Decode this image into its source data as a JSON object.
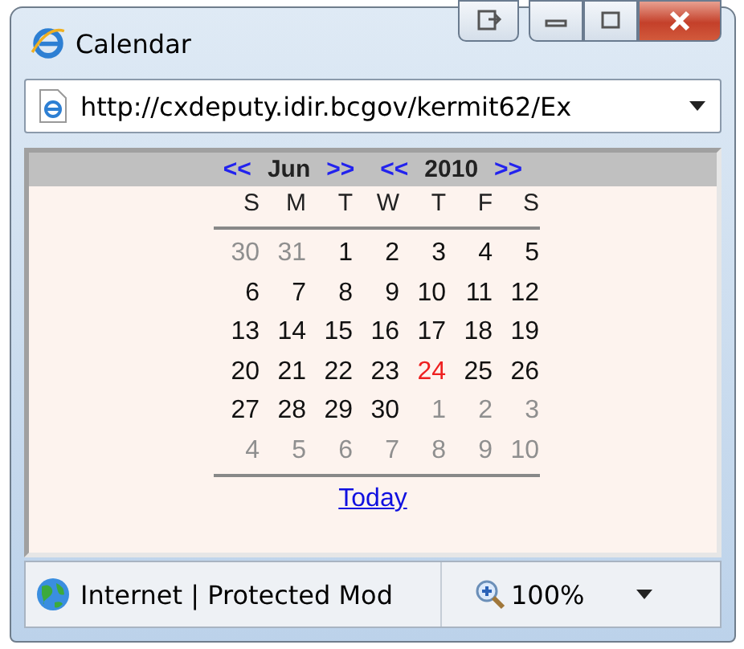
{
  "window": {
    "title": "Calendar"
  },
  "address_bar": {
    "value": "http://cxdeputy.idir.bcgov/kermit62/Ex"
  },
  "calendar": {
    "prev_month": "<<",
    "month": "Jun",
    "next_month": ">>",
    "prev_year": "<<",
    "year": "2010",
    "next_year": ">>",
    "weekdays": [
      "S",
      "M",
      "T",
      "W",
      "T",
      "F",
      "S"
    ],
    "weeks": [
      [
        {
          "day": "30",
          "other_month": true,
          "today": false
        },
        {
          "day": "31",
          "other_month": true,
          "today": false
        },
        {
          "day": "1",
          "other_month": false,
          "today": false
        },
        {
          "day": "2",
          "other_month": false,
          "today": false
        },
        {
          "day": "3",
          "other_month": false,
          "today": false
        },
        {
          "day": "4",
          "other_month": false,
          "today": false
        },
        {
          "day": "5",
          "other_month": false,
          "today": false
        }
      ],
      [
        {
          "day": "6",
          "other_month": false,
          "today": false
        },
        {
          "day": "7",
          "other_month": false,
          "today": false
        },
        {
          "day": "8",
          "other_month": false,
          "today": false
        },
        {
          "day": "9",
          "other_month": false,
          "today": false
        },
        {
          "day": "10",
          "other_month": false,
          "today": false
        },
        {
          "day": "11",
          "other_month": false,
          "today": false
        },
        {
          "day": "12",
          "other_month": false,
          "today": false
        }
      ],
      [
        {
          "day": "13",
          "other_month": false,
          "today": false
        },
        {
          "day": "14",
          "other_month": false,
          "today": false
        },
        {
          "day": "15",
          "other_month": false,
          "today": false
        },
        {
          "day": "16",
          "other_month": false,
          "today": false
        },
        {
          "day": "17",
          "other_month": false,
          "today": false
        },
        {
          "day": "18",
          "other_month": false,
          "today": false
        },
        {
          "day": "19",
          "other_month": false,
          "today": false
        }
      ],
      [
        {
          "day": "20",
          "other_month": false,
          "today": false
        },
        {
          "day": "21",
          "other_month": false,
          "today": false
        },
        {
          "day": "22",
          "other_month": false,
          "today": false
        },
        {
          "day": "23",
          "other_month": false,
          "today": false
        },
        {
          "day": "24",
          "other_month": false,
          "today": true
        },
        {
          "day": "25",
          "other_month": false,
          "today": false
        },
        {
          "day": "26",
          "other_month": false,
          "today": false
        }
      ],
      [
        {
          "day": "27",
          "other_month": false,
          "today": false
        },
        {
          "day": "28",
          "other_month": false,
          "today": false
        },
        {
          "day": "29",
          "other_month": false,
          "today": false
        },
        {
          "day": "30",
          "other_month": false,
          "today": false
        },
        {
          "day": "1",
          "other_month": true,
          "today": false
        },
        {
          "day": "2",
          "other_month": true,
          "today": false
        },
        {
          "day": "3",
          "other_month": true,
          "today": false
        }
      ],
      [
        {
          "day": "4",
          "other_month": true,
          "today": false
        },
        {
          "day": "5",
          "other_month": true,
          "today": false
        },
        {
          "day": "6",
          "other_month": true,
          "today": false
        },
        {
          "day": "7",
          "other_month": true,
          "today": false
        },
        {
          "day": "8",
          "other_month": true,
          "today": false
        },
        {
          "day": "9",
          "other_month": true,
          "today": false
        },
        {
          "day": "10",
          "other_month": true,
          "today": false
        }
      ]
    ],
    "today_link": "Today"
  },
  "status_bar": {
    "zone": "Internet | Protected Mod",
    "zoom": "100%"
  }
}
